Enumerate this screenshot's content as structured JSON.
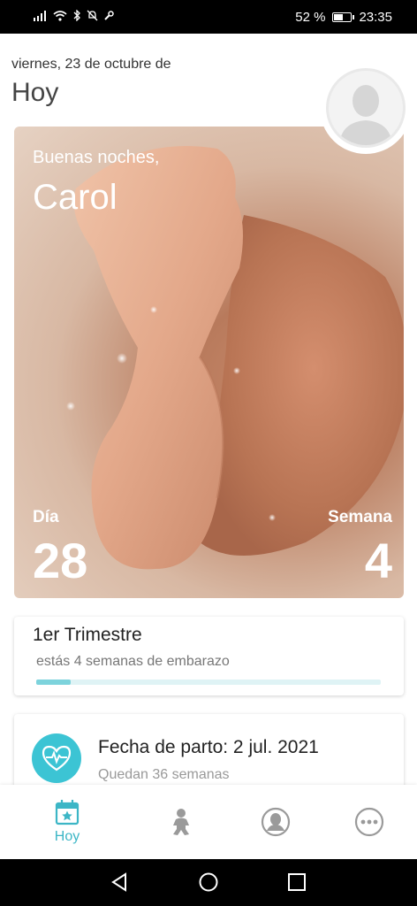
{
  "status_bar": {
    "battery_text": "52 %",
    "battery_level": 0.52,
    "time": "23:35"
  },
  "header": {
    "date": "viernes, 23 de octubre de",
    "title": "Hoy"
  },
  "hero": {
    "greeting": "Buenas noches,",
    "name": "Carol",
    "day_label": "Día",
    "day_value": "28",
    "week_label": "Semana",
    "week_value": "4"
  },
  "trimester": {
    "title": "1er Trimestre",
    "subtitle": "estás 4 semanas de embarazo",
    "progress": 0.1
  },
  "due_date": {
    "title": "Fecha de parto: 2 jul. 2021",
    "subtitle": "Quedan 36 semanas"
  },
  "bottom_nav": {
    "items": [
      {
        "label": "Hoy",
        "icon": "calendar-star-icon",
        "active": true
      },
      {
        "label": "",
        "icon": "baby-icon",
        "active": false
      },
      {
        "label": "",
        "icon": "mother-icon",
        "active": false
      },
      {
        "label": "",
        "icon": "more-icon",
        "active": false
      }
    ]
  },
  "colors": {
    "accent": "#3cb6c6",
    "progress_fill": "#7dd3dc",
    "progress_track": "#dff3f5",
    "icon_inactive": "#9a9a9a"
  }
}
